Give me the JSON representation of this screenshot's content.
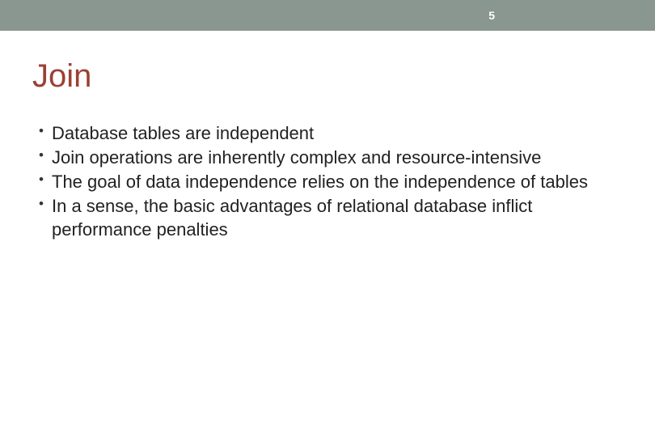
{
  "header": {
    "page_number": "5"
  },
  "slide": {
    "title": "Join",
    "bullets": [
      "Database tables are independent",
      "Join operations are inherently complex and resource-intensive",
      "The goal of data independence relies on the independence of tables",
      "In a sense, the basic advantages of relational database inflict performance penalties"
    ]
  }
}
